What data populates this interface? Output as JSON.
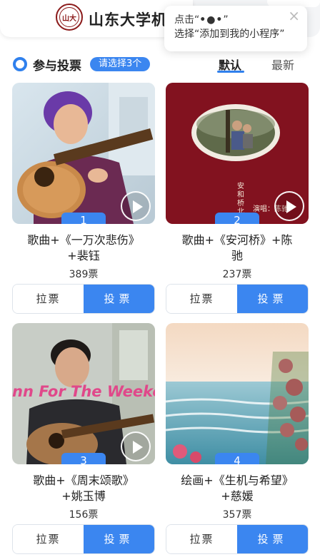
{
  "header": {
    "logo_text": "山大",
    "title": "山东大学机构"
  },
  "tooltip": {
    "line1_prefix": "点击“",
    "line1_dots": "•●•",
    "line1_suffix": "”",
    "line2": "选择“添加到我的小程序”",
    "close_icon": "×"
  },
  "section": {
    "title": "参与投票",
    "badge": "请选择3个",
    "sort_default": "默认",
    "sort_latest": "最新"
  },
  "cards": [
    {
      "number": "1",
      "title_line1": "歌曲+《一万次悲伤》",
      "title_line2": "+裴钰",
      "votes": "389票",
      "pull_label": "拉票",
      "vote_label": "投票"
    },
    {
      "number": "2",
      "title_line1": "歌曲+《安河桥》+陈",
      "title_line2": "驰",
      "votes": "237票",
      "pull_label": "拉票",
      "vote_label": "投票",
      "art_text_vertical": "安和桥北",
      "art_text_singer": "演唱：陈驰"
    },
    {
      "number": "3",
      "title_line1": "歌曲+《周末颂歌》",
      "title_line2": "+姚玉博",
      "votes": "156票",
      "pull_label": "拉票",
      "vote_label": "投票",
      "overlay_text": "nn For The Weeke"
    },
    {
      "number": "4",
      "title_line1": "绘画+《生机与希望》",
      "title_line2": "+慈媛",
      "votes": "357票",
      "pull_label": "拉票",
      "vote_label": "投票"
    }
  ],
  "colors": {
    "accent": "#3b86f0",
    "logo": "#8b1a1a"
  }
}
